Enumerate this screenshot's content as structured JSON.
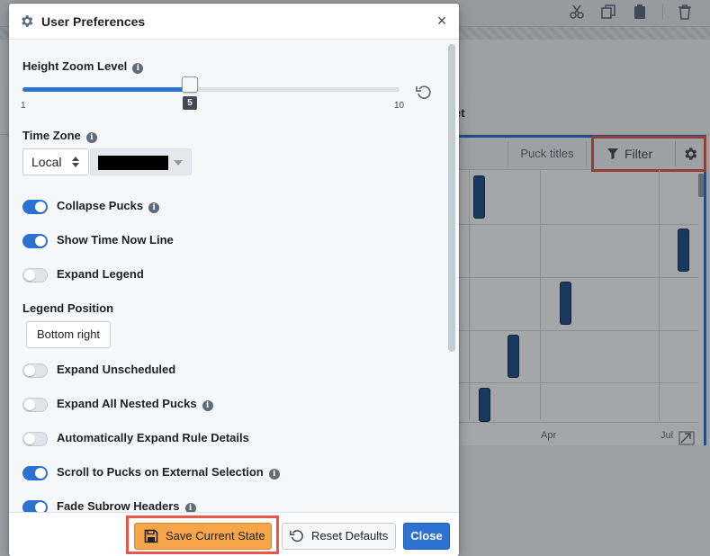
{
  "background": {
    "section_fragment": "et",
    "chart_header": {
      "puck_titles_label": "Puck titles",
      "filter_label": "Filter"
    },
    "axis_labels": [
      "Apr",
      "Jul"
    ],
    "highlight_color": "#e8584a"
  },
  "modal": {
    "title": "User Preferences",
    "height_zoom": {
      "label": "Height Zoom Level",
      "value": "5",
      "min": "1",
      "max": "10",
      "fraction": 0.444
    },
    "time_zone": {
      "label": "Time Zone",
      "selected": "Local",
      "secondary_value": "[redacted]"
    },
    "toggles": [
      {
        "label": "Collapse Pucks",
        "on": true,
        "info": true
      },
      {
        "label": "Show Time Now Line",
        "on": true,
        "info": false
      },
      {
        "label": "Expand Legend",
        "on": false,
        "info": false
      },
      {
        "label": "Expand Unscheduled",
        "on": false,
        "info": false
      },
      {
        "label": "Expand All Nested Pucks",
        "on": false,
        "info": true
      },
      {
        "label": "Automatically Expand Rule Details",
        "on": false,
        "info": false
      },
      {
        "label": "Scroll to Pucks on External Selection",
        "on": true,
        "info": true
      },
      {
        "label": "Fade Subrow Headers",
        "on": true,
        "info": true
      }
    ],
    "legend_position": {
      "label": "Legend Position",
      "value": "Bottom right"
    },
    "footer": {
      "save_label": "Save Current State",
      "reset_label": "Reset Defaults",
      "close_label": "Close"
    },
    "colors": {
      "primary": "#2d72d2",
      "save": "#f6a548",
      "highlight": "#e8584a"
    }
  }
}
